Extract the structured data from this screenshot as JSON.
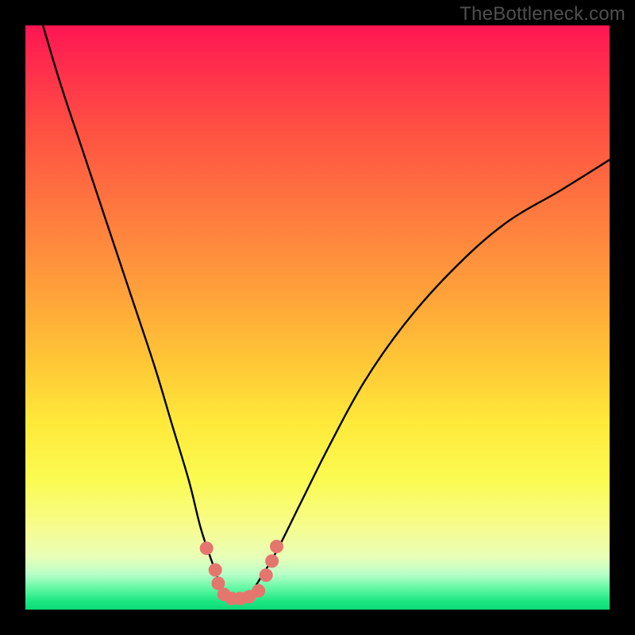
{
  "watermark": "TheBottleneck.com",
  "chart_data": {
    "type": "line",
    "title": "",
    "xlabel": "",
    "ylabel": "",
    "xlim": [
      0,
      100
    ],
    "ylim": [
      0,
      100
    ],
    "series": [
      {
        "name": "bottleneck-curve",
        "x": [
          3,
          6,
          10,
          14,
          18,
          22,
          25,
          28,
          30,
          32,
          33.5,
          35,
          36.5,
          38,
          40,
          43,
          47,
          52,
          58,
          65,
          73,
          82,
          92,
          100
        ],
        "y": [
          100,
          90,
          78,
          66,
          54,
          42,
          32,
          22,
          14,
          8,
          4,
          2,
          1.5,
          2,
          5,
          10,
          18,
          28,
          39,
          49,
          58,
          66,
          72,
          77
        ]
      }
    ],
    "markers": {
      "name": "highlight-dots",
      "color": "#e5766e",
      "points": [
        {
          "x": 31.0,
          "y": 10.5
        },
        {
          "x": 32.5,
          "y": 6.8
        },
        {
          "x": 33.0,
          "y": 4.5
        },
        {
          "x": 34.0,
          "y": 2.6
        },
        {
          "x": 35.3,
          "y": 1.9
        },
        {
          "x": 36.8,
          "y": 1.9
        },
        {
          "x": 38.3,
          "y": 2.2
        },
        {
          "x": 39.9,
          "y": 3.2
        },
        {
          "x": 41.2,
          "y": 5.9
        },
        {
          "x": 42.2,
          "y": 8.3
        },
        {
          "x": 43.0,
          "y": 10.8
        }
      ]
    },
    "gradient_stops": [
      {
        "pct": 0,
        "color": "#ff1552"
      },
      {
        "pct": 50,
        "color": "#ffbf38"
      },
      {
        "pct": 80,
        "color": "#fefd60"
      },
      {
        "pct": 100,
        "color": "#0cd978"
      }
    ]
  }
}
